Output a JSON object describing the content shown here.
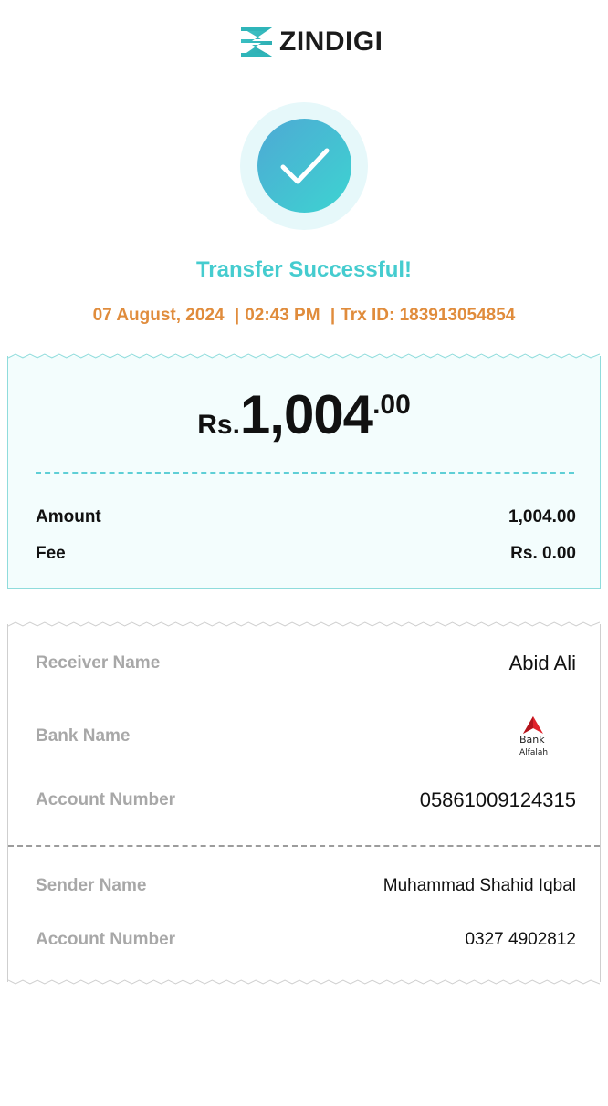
{
  "brand": {
    "name": "ZINDIGI",
    "accent": "#45cccf",
    "meta_color": "#e08c3c"
  },
  "status": {
    "icon": "check-icon",
    "title": "Transfer Successful!"
  },
  "meta": {
    "date": "07 August, 2024",
    "time": "02:43 PM",
    "trx": "Trx ID: 183913054854",
    "separator": "|"
  },
  "amount": {
    "currency": "Rs.",
    "whole": "1,004",
    "decimal": ".00"
  },
  "summary": [
    {
      "label": "Amount",
      "value": "1,004.00"
    },
    {
      "label": "Fee",
      "value": "Rs. 0.00"
    }
  ],
  "receiver": {
    "name_label": "Receiver Name",
    "name": "Abid Ali",
    "bank_label": "Bank Name",
    "bank_logo": {
      "word1": "Bank",
      "word2": "Alfalah",
      "icon": "bank-alfalah-logo"
    },
    "account_label": "Account Number",
    "account": "05861009124315"
  },
  "sender": {
    "name_label": "Sender Name",
    "name": "Muhammad Shahid Iqbal",
    "account_label": "Account Number",
    "account": "0327 4902812"
  }
}
